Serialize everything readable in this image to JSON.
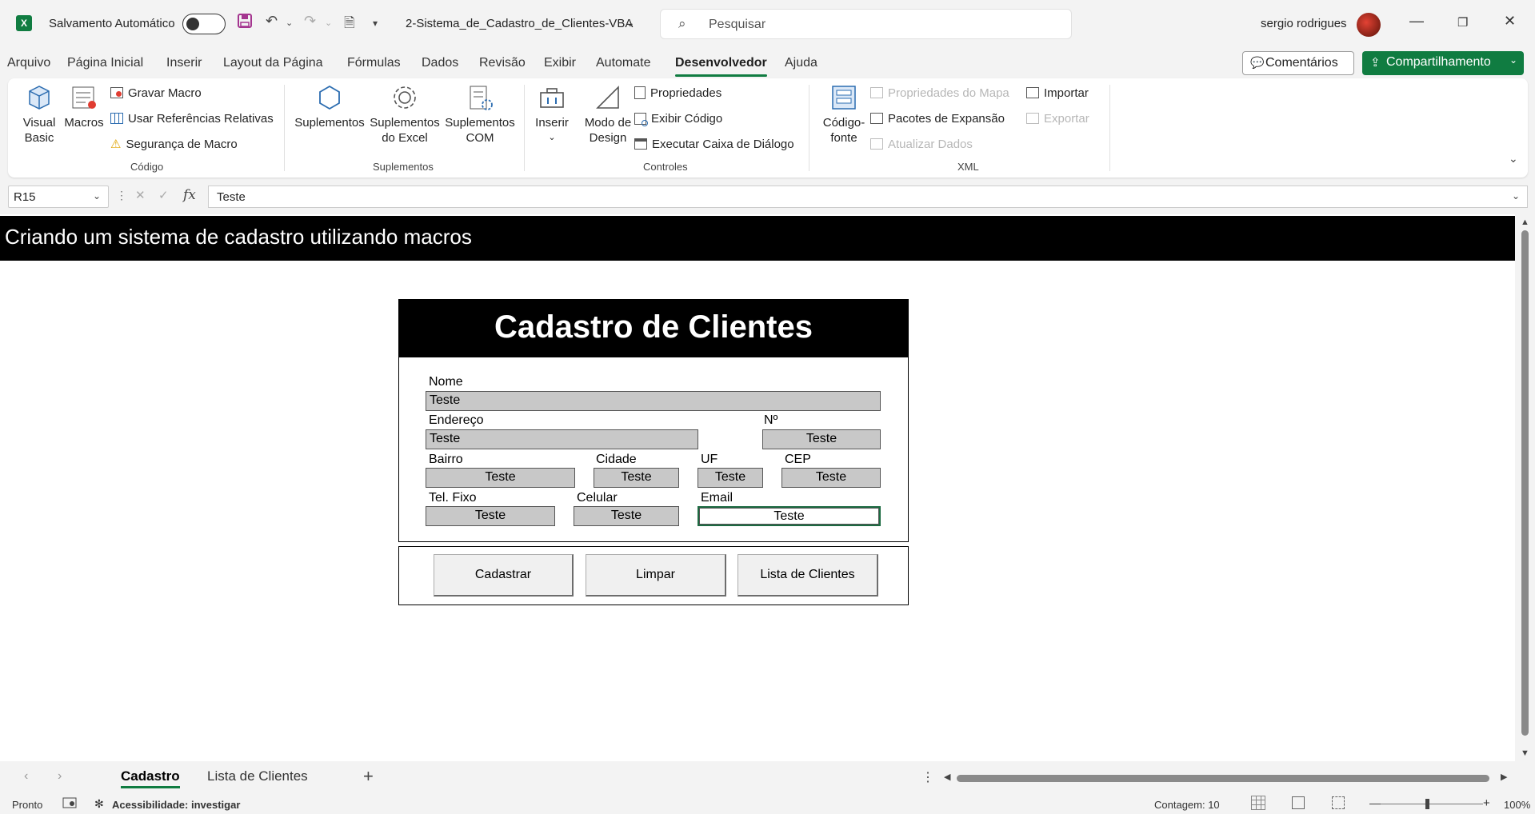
{
  "titlebar": {
    "app_logo": "X",
    "autosave_label": "Salvamento Automático",
    "autosave_on": false,
    "filename": "2-Sistema_de_Cadastro_de_Clientes-VBA",
    "search_placeholder": "Pesquisar",
    "user_name": "sergio rodrigues"
  },
  "menu_tabs": [
    "Arquivo",
    "Página Inicial",
    "Inserir",
    "Layout da Página",
    "Fórmulas",
    "Dados",
    "Revisão",
    "Exibir",
    "Automate",
    "Desenvolvedor",
    "Ajuda"
  ],
  "active_tab": "Desenvolvedor",
  "header_buttons": {
    "comments": "Comentários",
    "share": "Compartilhamento"
  },
  "ribbon": {
    "codigo": {
      "label": "Código",
      "visual_basic": "Visual Basic",
      "macros": "Macros",
      "gravar_macro": "Gravar Macro",
      "usar_referencias": "Usar Referências Relativas",
      "seguranca_macro": "Segurança de Macro"
    },
    "suplementos": {
      "label": "Suplementos",
      "suplementos": "Suplementos",
      "suplementos_excel": "Suplementos do Excel",
      "suplementos_com": "Suplementos COM"
    },
    "controles": {
      "label": "Controles",
      "inserir": "Inserir",
      "modo_design": "Modo de Design",
      "propriedades": "Propriedades",
      "exibir_codigo": "Exibir Código",
      "executar_caixa": "Executar Caixa de Diálogo"
    },
    "xml": {
      "label": "XML",
      "codigo_fonte": "Código-fonte",
      "propriedades_mapa": "Propriedades do Mapa",
      "pacotes_expansao": "Pacotes de Expansão",
      "atualizar_dados": "Atualizar Dados",
      "importar": "Importar",
      "exportar": "Exportar"
    }
  },
  "formula_bar": {
    "cell_ref": "R15",
    "fx": "fx",
    "content": "Teste"
  },
  "sheet": {
    "banner": "Criando um sistema de cadastro utilizando macros",
    "form": {
      "title": "Cadastro de Clientes",
      "labels": {
        "nome": "Nome",
        "endereco": "Endereço",
        "numero": "Nº",
        "bairro": "Bairro",
        "cidade": "Cidade",
        "uf": "UF",
        "cep": "CEP",
        "tel_fixo": "Tel. Fixo",
        "celular": "Celular",
        "email": "Email"
      },
      "values": {
        "nome": "Teste",
        "endereco": "Teste",
        "numero": "Teste",
        "bairro": "Teste",
        "cidade": "Teste",
        "uf": "Teste",
        "cep": "Teste",
        "tel_fixo": "Teste",
        "celular": "Teste",
        "email": "Teste"
      },
      "buttons": {
        "cadastrar": "Cadastrar",
        "limpar": "Limpar",
        "lista": "Lista de Clientes"
      }
    }
  },
  "sheet_tabs": [
    "Cadastro",
    "Lista de Clientes"
  ],
  "active_sheet": "Cadastro",
  "status_bar": {
    "ready": "Pronto",
    "accessibility": "Acessibilidade: investigar",
    "count": "Contagem: 10",
    "zoom": "100%"
  },
  "colors": {
    "accent": "#107c41",
    "banner_bg": "#000000",
    "field_bg": "#c8c8c8"
  }
}
